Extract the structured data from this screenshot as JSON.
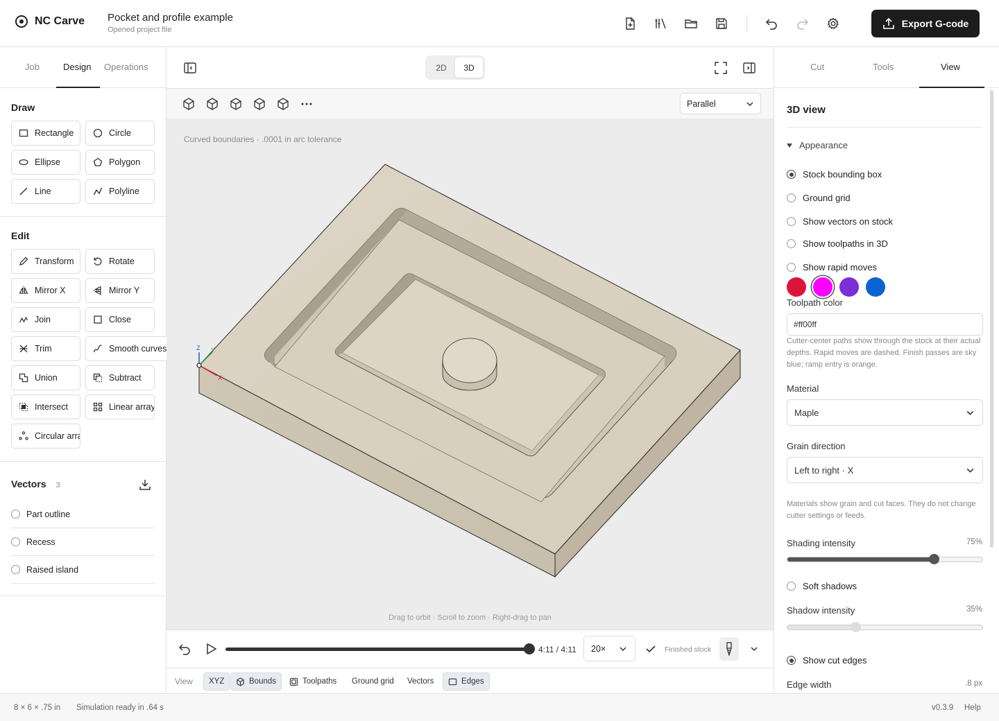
{
  "app": {
    "name": "NC Carve"
  },
  "project": {
    "title": "Pocket and profile example",
    "subtitle": "Opened project file"
  },
  "toolbar": {
    "export_label": "Export G-code"
  },
  "left": {
    "tabs": [
      "Job",
      "Design",
      "Operations"
    ],
    "draw_title": "Draw",
    "draw_tools": [
      "Rectangle",
      "Circle",
      "Ellipse",
      "Polygon",
      "Line",
      "Polyline"
    ],
    "edit_title": "Edit",
    "edit_tools": [
      "Transform",
      "Rotate",
      "Mirror X",
      "Mirror Y",
      "Join",
      "Close",
      "Trim",
      "Smooth curves",
      "Union",
      "Subtract",
      "Intersect",
      "Linear array",
      "Circular array"
    ],
    "vectors_title": "Vectors",
    "vectors_count": "3",
    "vectors": [
      "Part outline",
      "Recess",
      "Raised island"
    ]
  },
  "center": {
    "mode_2d": "2D",
    "mode_3d": "3D",
    "projection": "Parallel",
    "note": "Curved boundaries · .0001 in arc tolerance",
    "hint": "Drag to orbit · Scroll to zoom · Right-drag to pan",
    "axes": {
      "x": "X",
      "y": "Y",
      "z": "Z"
    },
    "playback": {
      "time": "4:11 / 4:11",
      "progress": 1.0,
      "speed": "20×",
      "status": "Finished stock"
    },
    "viewbar": {
      "label": "View",
      "chips": [
        {
          "label": "XYZ",
          "on": true
        },
        {
          "label": "Bounds",
          "on": true
        },
        {
          "label": "Toolpaths",
          "on": false
        },
        {
          "label": "Ground grid",
          "on": false
        },
        {
          "label": "Vectors",
          "on": false
        },
        {
          "label": "Edges",
          "on": true
        }
      ]
    }
  },
  "right": {
    "tabs": [
      "Cut",
      "Tools",
      "View"
    ],
    "title": "3D view",
    "appearance": "Appearance",
    "options": [
      {
        "label": "Stock bounding box",
        "checked": true
      },
      {
        "label": "Ground grid",
        "checked": false
      },
      {
        "label": "Show vectors on stock",
        "checked": false
      },
      {
        "label": "Show toolpaths in 3D",
        "checked": false
      },
      {
        "label": "Show rapid moves",
        "checked": false
      }
    ],
    "swatches": [
      "#dc143c",
      "#ff00ff",
      "#7b2fd6",
      "#0b63d1"
    ],
    "selected_swatch": 1,
    "toolpath_color_label": "Toolpath color",
    "toolpath_color_value": "#ff00ff",
    "toolpath_help": "Cutter-center paths show through the stock at their actual depths. Rapid moves are dashed. Finish passes are sky blue; ramp entry is orange.",
    "material_label": "Material",
    "material_value": "Maple",
    "grain_label": "Grain direction",
    "grain_value": "Left to right · X",
    "material_help": "Materials show grain and cut faces. They do not change cutter settings or feeds.",
    "shading_label": "Shading intensity",
    "shading_value": "75%",
    "shading": 0.75,
    "soft_shadows": "Soft shadows",
    "shadow_label": "Shadow intensity",
    "shadow_value": "35%",
    "shadow": 0.35,
    "cut_edges": "Show cut edges",
    "edge_width_label": "Edge width",
    "edge_width_value": ".8 px"
  },
  "status": {
    "dims": "8 × 6 × .75 in",
    "sim": "Simulation ready in .64 s",
    "version": "v0.3.9",
    "help": "Help"
  },
  "colors": {
    "wood": "#ddd5c5",
    "accent": "#1c1c1c"
  }
}
